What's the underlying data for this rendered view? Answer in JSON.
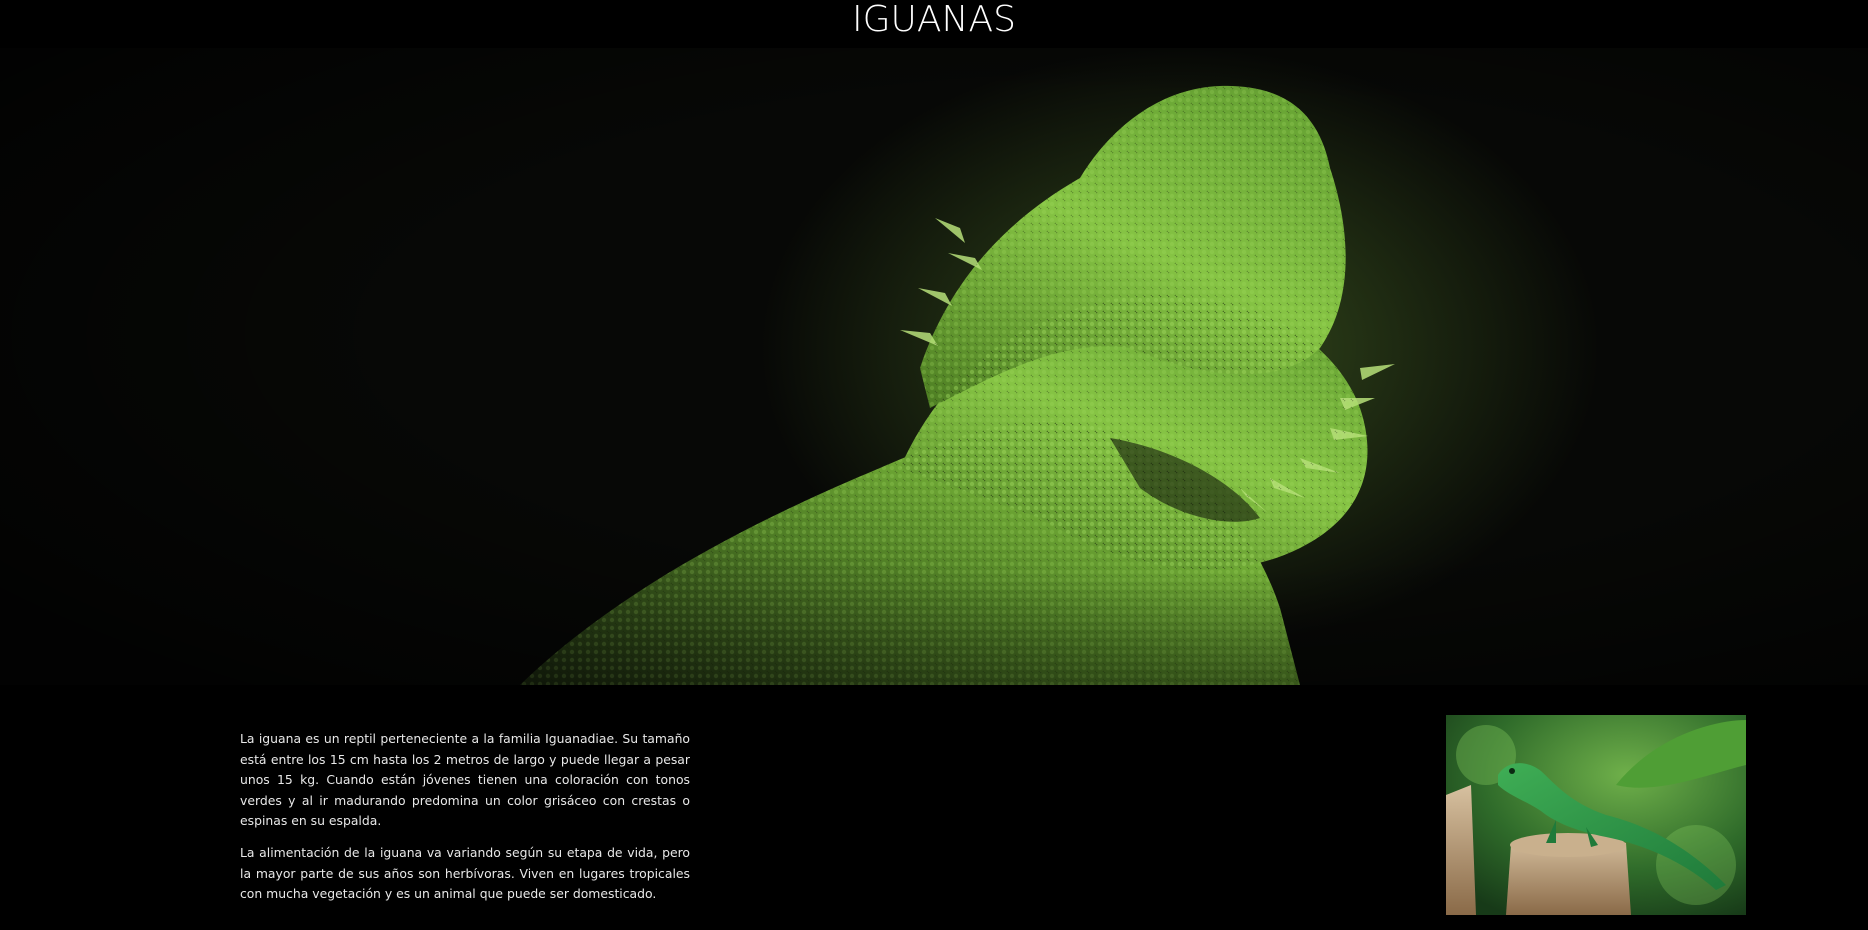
{
  "header": {
    "title": "IGUANAS"
  },
  "hero": {
    "image_icon": "iguana-hero-photo"
  },
  "content": {
    "paragraphs": [
      "La iguana es un reptil perteneciente a la familia Iguanadiae. Su tamaño está entre los 15 cm hasta los 2 metros de largo y puede llegar a pesar unos 15 kg. Cuando están jóvenes tienen una coloración con tonos verdes y al ir madurando predomina un color grisáceo con crestas o espinas en su espalda.",
      "La alimentación de la iguana va variando según su etapa de vida, pero la mayor parte de sus años son herbívoras. Viven en lugares tropicales con mucha vegetación y es un animal que puede ser domesticado."
    ],
    "side_image_icon": "green-iguana-photo"
  },
  "colors": {
    "background": "#000000",
    "text": "#e8e8e8",
    "title": "#ffffff",
    "iguana_green": "#6fae3a"
  }
}
